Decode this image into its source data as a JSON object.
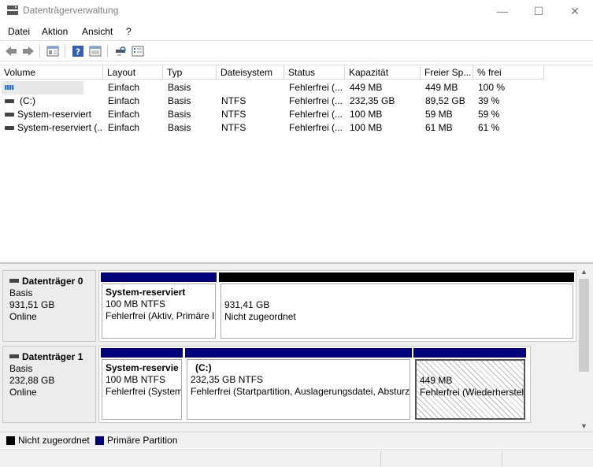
{
  "window": {
    "title": "Datenträgerverwaltung",
    "minimize": "—",
    "maximize": "☐",
    "close": "✕"
  },
  "menu": [
    "Datei",
    "Aktion",
    "Ansicht",
    "?"
  ],
  "toolbar": {
    "icons": [
      "back-icon",
      "forward-icon",
      "properties-icon",
      "help-icon",
      "view-icon",
      "rescan-icon",
      "list-icon"
    ]
  },
  "volume_list": {
    "columns": [
      "Volume",
      "Layout",
      "Typ",
      "Dateisystem",
      "Status",
      "Kapazität",
      "Freier Sp...",
      "% frei"
    ],
    "rows": [
      {
        "volume": "",
        "layout": "Einfach",
        "typ": "Basis",
        "fs": "",
        "status": "Fehlerfrei (...",
        "kapazitaet": "449 MB",
        "frei": "449 MB",
        "prozent": "100 %"
      },
      {
        "volume": "(C:)",
        "layout": "Einfach",
        "typ": "Basis",
        "fs": "NTFS",
        "status": "Fehlerfrei (...",
        "kapazitaet": "232,35 GB",
        "frei": "89,52 GB",
        "prozent": "39 %"
      },
      {
        "volume": "System-reserviert",
        "layout": "Einfach",
        "typ": "Basis",
        "fs": "NTFS",
        "status": "Fehlerfrei (...",
        "kapazitaet": "100 MB",
        "frei": "59 MB",
        "prozent": "59 %"
      },
      {
        "volume": "System-reserviert (...",
        "layout": "Einfach",
        "typ": "Basis",
        "fs": "NTFS",
        "status": "Fehlerfrei (...",
        "kapazitaet": "100 MB",
        "frei": "61 MB",
        "prozent": "61 %"
      }
    ]
  },
  "disks": [
    {
      "name": "Datenträger 0",
      "type": "Basis",
      "size": "931,51 GB",
      "state": "Online",
      "partitions": [
        {
          "title": "System-reserviert",
          "line1": "100 MB NTFS",
          "line2": "Fehlerfrei (Aktiv, Primäre I"
        },
        {
          "title": "",
          "line1": "931,41 GB",
          "line2": "Nicht zugeordnet"
        }
      ]
    },
    {
      "name": "Datenträger 1",
      "type": "Basis",
      "size": "232,88 GB",
      "state": "Online",
      "partitions": [
        {
          "title": "System-reservie",
          "line1": "100 MB NTFS",
          "line2": "Fehlerfrei (System"
        },
        {
          "title": "(C:)",
          "line1": "232,35 GB NTFS",
          "line2": "Fehlerfrei (Startpartition, Auslagerungsdatei, Absturz"
        },
        {
          "title": "",
          "line1": "449 MB",
          "line2": "Fehlerfrei (Wiederherstel"
        }
      ]
    }
  ],
  "legend": {
    "unallocated": "Nicht zugeordnet",
    "primary": "Primäre Partition",
    "unallocated_color": "#000000",
    "primary_color": "#00007b"
  }
}
